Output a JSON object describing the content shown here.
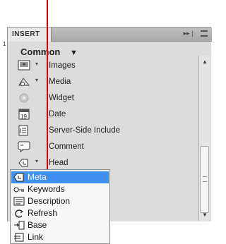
{
  "panel": {
    "tab_label": "INSERT",
    "tab_controls": "▸▸ |",
    "category": "Common",
    "category_arrow": "▼",
    "items": [
      {
        "label": "Images",
        "icon": "image-icon",
        "has_dropdown": true
      },
      {
        "label": "Media",
        "icon": "media-icon",
        "has_dropdown": true
      },
      {
        "label": "Widget",
        "icon": "widget-icon",
        "has_dropdown": false
      },
      {
        "label": "Date",
        "icon": "calendar-icon",
        "has_dropdown": false
      },
      {
        "label": "Server-Side Include",
        "icon": "server-include-icon",
        "has_dropdown": false
      },
      {
        "label": "Comment",
        "icon": "comment-icon",
        "has_dropdown": false
      },
      {
        "label": "Head",
        "icon": "head-icon",
        "has_dropdown": true
      }
    ],
    "dropdown_glyph": "▾",
    "left_mark": "1"
  },
  "head_menu": {
    "items": [
      {
        "label": "Meta",
        "icon": "meta-icon",
        "selected": true
      },
      {
        "label": "Keywords",
        "icon": "keywords-icon",
        "selected": false
      },
      {
        "label": "Description",
        "icon": "description-icon",
        "selected": false
      },
      {
        "label": "Refresh",
        "icon": "refresh-icon",
        "selected": false
      },
      {
        "label": "Base",
        "icon": "base-icon",
        "selected": false
      },
      {
        "label": "Link",
        "icon": "link-icon",
        "selected": false
      }
    ]
  },
  "annotation": {
    "color": "#e00000"
  },
  "colors": {
    "selection": "#3f8ff0",
    "panel_bg": "#dcdcdc"
  }
}
